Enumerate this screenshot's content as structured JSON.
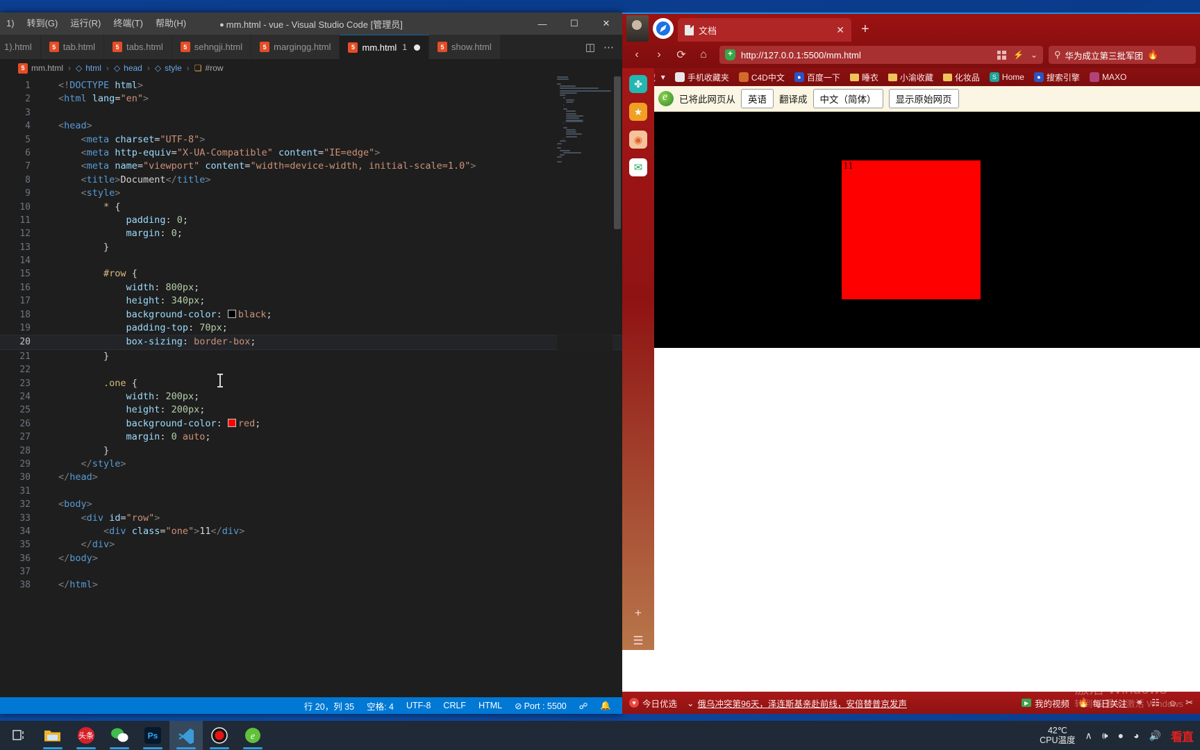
{
  "vscode": {
    "menu": [
      "1)",
      "转到(G)",
      "运行(R)",
      "终端(T)",
      "帮助(H)"
    ],
    "title": "mm.html - vue - Visual Studio Code [管理员]",
    "window_controls": {
      "minimize": "—",
      "maximize": "☐",
      "close": "✕"
    },
    "tabs": [
      {
        "label": "1).html",
        "icon": "html5-icon",
        "active": false,
        "partial": true,
        "badge": "",
        "dirty": false
      },
      {
        "label": "tab.html",
        "icon": "html5-icon",
        "active": false,
        "partial": false,
        "badge": "",
        "dirty": false
      },
      {
        "label": "tabs.html",
        "icon": "html5-icon",
        "active": false,
        "partial": false,
        "badge": "",
        "dirty": false
      },
      {
        "label": "sehngji.html",
        "icon": "html5-icon",
        "active": false,
        "partial": false,
        "badge": "",
        "dirty": false
      },
      {
        "label": "margingg.html",
        "icon": "html5-icon",
        "active": false,
        "partial": false,
        "badge": "",
        "dirty": false
      },
      {
        "label": "mm.html",
        "icon": "html5-icon",
        "active": true,
        "partial": false,
        "badge": "1",
        "dirty": true
      },
      {
        "label": "show.html",
        "icon": "html5-icon",
        "active": false,
        "partial": false,
        "badge": "",
        "dirty": false
      }
    ],
    "tab_actions": {
      "split_editor": "split-editor-icon",
      "more": "⋯"
    },
    "breadcrumb": [
      "mm.html",
      "html",
      "head",
      "style",
      "#row"
    ],
    "code_lines": [
      {
        "n": 1,
        "html": "<span class='punc'>&lt;!</span><span class='tagname'>DOCTYPE</span> <span class='attr'>html</span><span class='punc'>&gt;</span>"
      },
      {
        "n": 2,
        "html": "<span class='punc'>&lt;</span><span class='tagname'>html</span> <span class='attr'>lang</span><span class='plain'>=</span><span class='str'>\"en\"</span><span class='punc'>&gt;</span>"
      },
      {
        "n": 3,
        "html": ""
      },
      {
        "n": 4,
        "html": "<span class='punc'>&lt;</span><span class='tagname'>head</span><span class='punc'>&gt;</span>"
      },
      {
        "n": 5,
        "html": "    <span class='punc'>&lt;</span><span class='tagname'>meta</span> <span class='attr'>charset</span><span class='plain'>=</span><span class='str'>\"UTF-8\"</span><span class='punc'>&gt;</span>"
      },
      {
        "n": 6,
        "html": "    <span class='punc'>&lt;</span><span class='tagname'>meta</span> <span class='attr'>http-equiv</span><span class='plain'>=</span><span class='str'>\"X-UA-Compatible\"</span> <span class='attr'>content</span><span class='plain'>=</span><span class='str'>\"IE=edge\"</span><span class='punc'>&gt;</span>"
      },
      {
        "n": 7,
        "html": "    <span class='punc'>&lt;</span><span class='tagname'>meta</span> <span class='attr'>name</span><span class='plain'>=</span><span class='str'>\"viewport\"</span> <span class='attr'>content</span><span class='plain'>=</span><span class='str'>\"width=device-width, initial-scale=1.0\"</span><span class='punc'>&gt;</span>"
      },
      {
        "n": 8,
        "html": "    <span class='punc'>&lt;</span><span class='tagname'>title</span><span class='punc'>&gt;</span><span class='plain'>Document</span><span class='punc'>&lt;/</span><span class='tagname'>title</span><span class='punc'>&gt;</span>"
      },
      {
        "n": 9,
        "html": "    <span class='punc'>&lt;</span><span class='tagname'>style</span><span class='punc'>&gt;</span>"
      },
      {
        "n": 10,
        "html": "        <span class='sel'>*</span> <span class='brace'>{</span>"
      },
      {
        "n": 11,
        "html": "            <span class='prop'>padding</span><span class='plain'>: </span><span class='num'>0</span><span class='plain'>;</span>"
      },
      {
        "n": 12,
        "html": "            <span class='prop'>margin</span><span class='plain'>: </span><span class='num'>0</span><span class='plain'>;</span>"
      },
      {
        "n": 13,
        "html": "        <span class='brace'>}</span>"
      },
      {
        "n": 14,
        "html": ""
      },
      {
        "n": 15,
        "html": "        <span class='sel'>#row</span> <span class='brace'>{</span>"
      },
      {
        "n": 16,
        "html": "            <span class='prop'>width</span><span class='plain'>: </span><span class='num'>800px</span><span class='plain'>;</span>"
      },
      {
        "n": 17,
        "html": "            <span class='prop'>height</span><span class='plain'>: </span><span class='num'>340px</span><span class='plain'>;</span>"
      },
      {
        "n": 18,
        "html": "            <span class='prop'>background-color</span><span class='plain'>: </span><span class='swatch' style='background:#000'></span><span class='val'>black</span><span class='plain'>;</span>"
      },
      {
        "n": 19,
        "html": "            <span class='prop'>padding-top</span><span class='plain'>: </span><span class='num'>70px</span><span class='plain'>;</span>"
      },
      {
        "n": 20,
        "html": "            <span class='prop'>box-sizing</span><span class='plain'>: </span><span class='val'>border-box</span><span class='plain'>;</span>",
        "current": true
      },
      {
        "n": 21,
        "html": "        <span class='brace'>}</span>"
      },
      {
        "n": 22,
        "html": ""
      },
      {
        "n": 23,
        "html": "        <span class='sel'>.one</span> <span class='brace'>{</span>"
      },
      {
        "n": 24,
        "html": "            <span class='prop'>width</span><span class='plain'>: </span><span class='num'>200px</span><span class='plain'>;</span>"
      },
      {
        "n": 25,
        "html": "            <span class='prop'>height</span><span class='plain'>: </span><span class='num'>200px</span><span class='plain'>;</span>"
      },
      {
        "n": 26,
        "html": "            <span class='prop'>background-color</span><span class='plain'>: </span><span class='swatch' style='background:#ff0000'></span><span class='val'>red</span><span class='plain'>;</span>"
      },
      {
        "n": 27,
        "html": "            <span class='prop'>margin</span><span class='plain'>: </span><span class='num'>0</span> <span class='val'>auto</span><span class='plain'>;</span>"
      },
      {
        "n": 28,
        "html": "        <span class='brace'>}</span>"
      },
      {
        "n": 29,
        "html": "    <span class='punc'>&lt;/</span><span class='tagname'>style</span><span class='punc'>&gt;</span>"
      },
      {
        "n": 30,
        "html": "<span class='punc'>&lt;/</span><span class='tagname'>head</span><span class='punc'>&gt;</span>"
      },
      {
        "n": 31,
        "html": ""
      },
      {
        "n": 32,
        "html": "<span class='punc'>&lt;</span><span class='tagname'>body</span><span class='punc'>&gt;</span>"
      },
      {
        "n": 33,
        "html": "    <span class='punc'>&lt;</span><span class='tagname'>div</span> <span class='attr'>id</span><span class='plain'>=</span><span class='str'>\"row\"</span><span class='punc'>&gt;</span>"
      },
      {
        "n": 34,
        "html": "        <span class='punc'>&lt;</span><span class='tagname'>div</span> <span class='attr'>class</span><span class='plain'>=</span><span class='str'>\"one\"</span><span class='punc'>&gt;</span><span class='plain'>11</span><span class='punc'>&lt;/</span><span class='tagname'>div</span><span class='punc'>&gt;</span>"
      },
      {
        "n": 35,
        "html": "    <span class='punc'>&lt;/</span><span class='tagname'>div</span><span class='punc'>&gt;</span>"
      },
      {
        "n": 36,
        "html": "<span class='punc'>&lt;/</span><span class='tagname'>body</span><span class='punc'>&gt;</span>"
      },
      {
        "n": 37,
        "html": ""
      },
      {
        "n": 38,
        "html": "<span class='punc'>&lt;/</span><span class='tagname'>html</span><span class='punc'>&gt;</span>"
      }
    ],
    "status_bar": {
      "cursor": "行 20，列 35",
      "indent": "空格: 4",
      "encoding": "UTF-8",
      "eol": "CRLF",
      "language": "HTML",
      "port": "Port : 5500",
      "port_icon": "no-entry-icon",
      "broadcast_icon": "broadcast-icon",
      "bell_icon": "bell-icon"
    }
  },
  "browser": {
    "avatar": "user-avatar",
    "logo": "compass-logo-icon",
    "tab": {
      "title": "文档",
      "icon": "page-icon",
      "close": "✕"
    },
    "new_tab": "+",
    "nav": {
      "back": "‹",
      "forward": "›",
      "reload": "⟳",
      "home": "⌂"
    },
    "url": "http://127.0.0.1:5500/mm.html",
    "url_shield": "shield-icon",
    "url_actions": {
      "qr": "qr-icon",
      "lightning": "⚡",
      "chevron": "⌄"
    },
    "search": {
      "placeholder": "华为成立第三批军团",
      "icon": "search-icon",
      "flame": "hot-icon"
    },
    "bookmarks": [
      {
        "label": "收藏",
        "icon": "star-icon",
        "caret": "▾"
      },
      {
        "label": "手机收藏夹",
        "icon": "phone-icon"
      },
      {
        "label": "C4D中文",
        "icon": "c4d-icon"
      },
      {
        "label": "百度一下",
        "icon": "baidu-icon"
      },
      {
        "label": "睡衣",
        "icon": "folder-icon"
      },
      {
        "label": "小渝收藏",
        "icon": "folder-icon"
      },
      {
        "label": "化妆品",
        "icon": "folder-icon"
      },
      {
        "label": "Home",
        "icon": "s-icon"
      },
      {
        "label": "搜索引擎",
        "icon": "baidu-icon"
      },
      {
        "label": "MAXO",
        "icon": "maxon-icon"
      }
    ],
    "sidebar": [
      {
        "name": "clover-icon",
        "glyph": "✤",
        "color": "#22b7b0"
      },
      {
        "name": "star-icon",
        "glyph": "★",
        "color": "#f0a022"
      },
      {
        "name": "weibo-icon",
        "glyph": "◉",
        "color": "#f5c39b"
      },
      {
        "name": "mail-icon",
        "glyph": "✉",
        "color": "#ffffff"
      },
      {
        "name": "add-icon",
        "glyph": "+",
        "color": "transparent"
      },
      {
        "name": "list-icon",
        "glyph": "☰",
        "color": "transparent"
      }
    ],
    "translate_bar": {
      "icon": "ie-icon",
      "prefix": "已将此网页从",
      "from_lang": "英语",
      "middle": "翻译成",
      "to_lang": "中文（简体）",
      "show_original": "显示原始网页"
    },
    "page": {
      "row_text": "",
      "one_text": "11",
      "row_color": "#000000",
      "one_color": "#ff0000"
    },
    "ticker": {
      "today_label": "今日优选",
      "chevron": "⌄",
      "headline": "俄乌冲突第96天，泽连斯基亲赴前线，安倍替普京发声",
      "my_video": "我的视频",
      "daily_focus": "每日关注",
      "icons": [
        "shield-icon",
        "image-icon",
        "smile-icon",
        "scissors-icon"
      ]
    },
    "watermark": {
      "line1": "激活 Windows",
      "line2": "转到\"设置\"以激活 Windows"
    }
  },
  "taskbar": {
    "items": [
      {
        "name": "task-view-button",
        "label": "任务视图"
      },
      {
        "name": "file-explorer-button",
        "label": "文件资源管理器"
      },
      {
        "name": "toutiao-button",
        "label": "头条"
      },
      {
        "name": "wechat-button",
        "label": "微信"
      },
      {
        "name": "photoshop-button",
        "label": "Ps"
      },
      {
        "name": "vscode-button",
        "label": "Visual Studio Code"
      },
      {
        "name": "recorder-button",
        "label": "录屏"
      },
      {
        "name": "browser-button",
        "label": "360浏览器"
      }
    ],
    "tray": {
      "cpu_temp_value": "42℃",
      "cpu_temp_label": "CPU温度",
      "chevron": "∧",
      "mic": "Ἲ4",
      "wifi": "wifi-icon",
      "volume": "volume-icon",
      "red_text": "看直"
    }
  }
}
